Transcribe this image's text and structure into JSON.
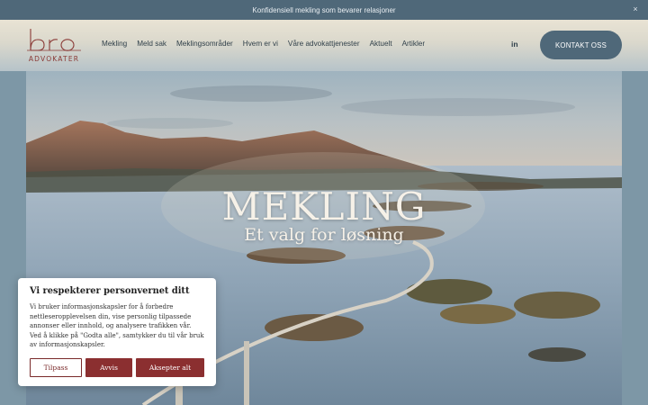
{
  "announcement": {
    "text": "Konfidensiell mekling som bevarer relasjoner",
    "close_glyph": "×"
  },
  "header": {
    "logo": {
      "mark": "bro",
      "subtitle": "ADVOKATER",
      "color": "#8a3a36"
    },
    "nav": [
      "Mekling",
      "Meld sak",
      "Meklingsområder",
      "Hvem er vi",
      "Våre advokattjenester",
      "Aktuelt",
      "Artikler"
    ],
    "social_label": "in",
    "contact_label": "KONTAKT OSS",
    "accent": "#4f6879"
  },
  "hero": {
    "title": "MEKLING",
    "subtitle": "Et valg for løsning"
  },
  "cookie": {
    "title": "Vi respekterer personvernet ditt",
    "body": "Vi bruker informasjonskapsler for å forbedre nettleseropplevelsen din, vise personlig tilpassede annonser eller innhold, og analysere trafikken vår. Ved å klikke på \"Godta alle\", samtykker du til vår bruk av informasjonskapsler.",
    "buttons": {
      "customize": "Tilpass",
      "reject": "Avvis",
      "accept": "Aksepter alt"
    },
    "brand_color": "#8b2f30"
  }
}
